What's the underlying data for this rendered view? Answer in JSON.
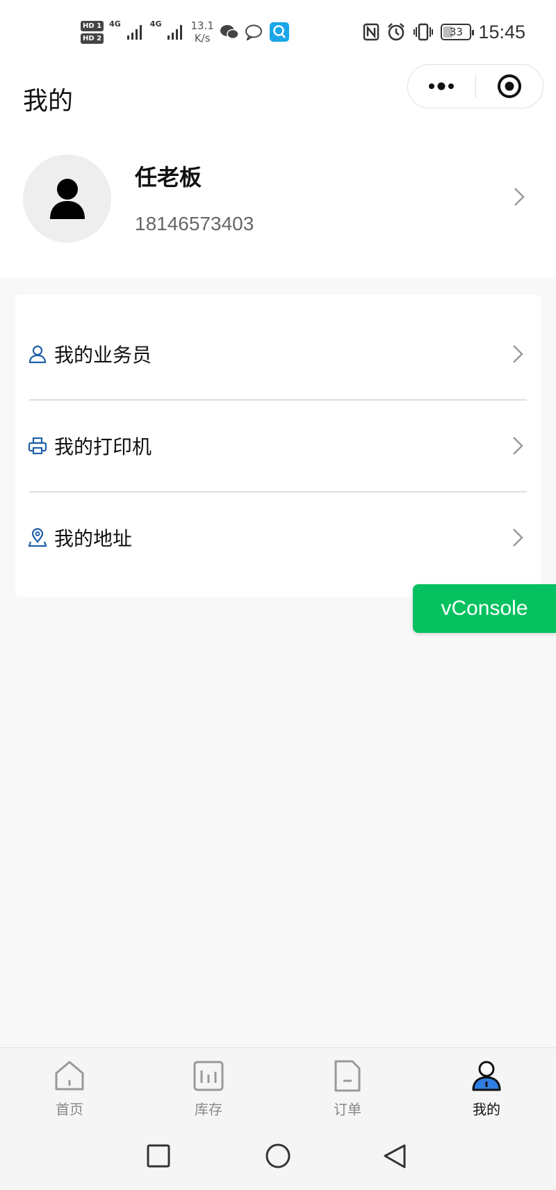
{
  "status_bar": {
    "sim1": "HD 1",
    "sim2": "HD 2",
    "net1": "4G",
    "net2": "4G",
    "speed_value": "13.1",
    "speed_unit": "K/s",
    "battery": "33",
    "time": "15:45"
  },
  "nav": {
    "title": "我的"
  },
  "profile": {
    "name": "任老板",
    "phone": "18146573403"
  },
  "menu": {
    "items": [
      {
        "label": "我的业务员",
        "icon": "person-icon"
      },
      {
        "label": "我的打印机",
        "icon": "printer-icon"
      },
      {
        "label": "我的地址",
        "icon": "location-icon"
      }
    ]
  },
  "vconsole": {
    "label": "vConsole"
  },
  "tabbar": {
    "tabs": [
      {
        "label": "首页",
        "icon": "home-icon"
      },
      {
        "label": "库存",
        "icon": "inventory-icon"
      },
      {
        "label": "订单",
        "icon": "order-icon"
      },
      {
        "label": "我的",
        "icon": "user-icon"
      }
    ],
    "active_index": 3
  },
  "colors": {
    "accent_blue": "#1f5fa8",
    "vconsole_green": "#07c160",
    "background": "#f8f8f8"
  }
}
